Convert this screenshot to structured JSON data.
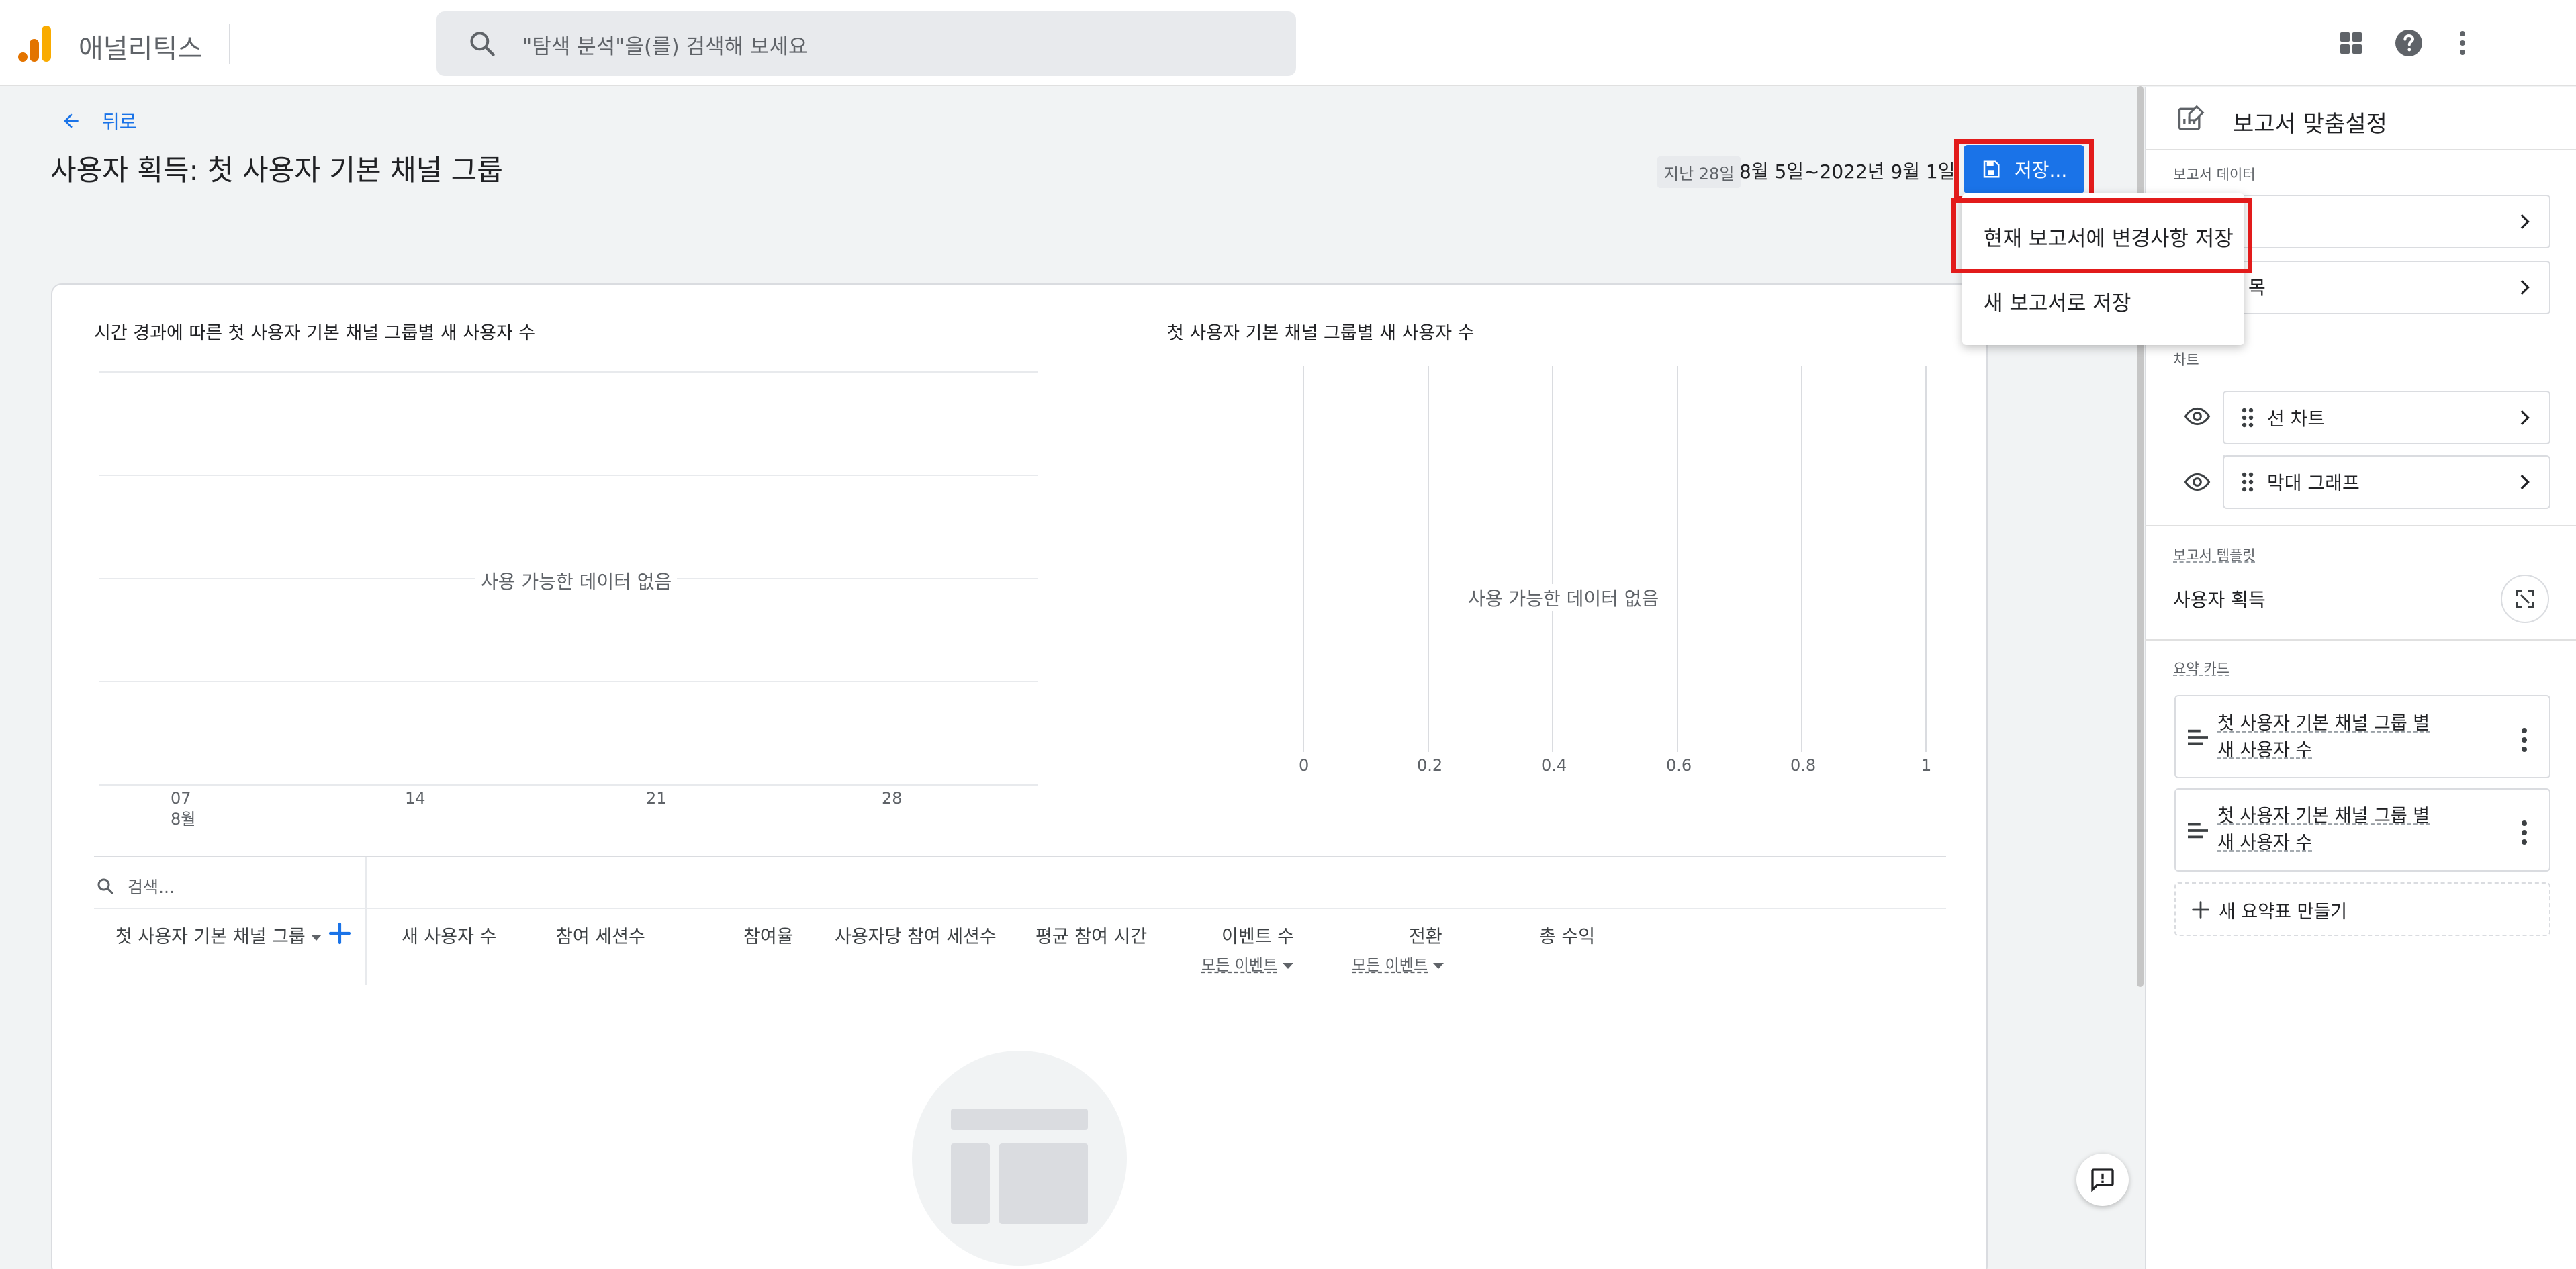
{
  "topbar": {
    "app_title": "애널리틱스",
    "search_placeholder": "\"탐색 분석\"을(를) 검색해 보세요"
  },
  "header": {
    "back_label": "뒤로",
    "page_title": "사용자 획득: 첫 사용자 기본 채널 그룹",
    "date_chip": "지난 28일",
    "date_range": "8월 5일~2022년 9월 1일",
    "save_label": "저장..."
  },
  "save_menu": {
    "items": [
      "현재 보고서에 변경사항 저장",
      "새 보고서로 저장"
    ]
  },
  "line_chart": {
    "title": "시간 경과에 따른 첫 사용자 기본 채널 그룹별 새 사용자 수",
    "no_data": "사용 가능한 데이터 없음",
    "x_ticks": [
      "07",
      "14",
      "21",
      "28"
    ],
    "x_month": "8월"
  },
  "bar_chart": {
    "title": "첫 사용자 기본 채널 그룹별 새 사용자 수",
    "no_data": "사용 가능한 데이터 없음",
    "x_ticks": [
      "0",
      "0.2",
      "0.4",
      "0.6",
      "0.8",
      "1"
    ]
  },
  "table": {
    "search_placeholder": "검색...",
    "dimension_header": "첫 사용자 기본 채널 그룹",
    "columns": [
      "새 사용자 수",
      "참여 세션수",
      "참여율",
      "사용자당 참여 세션수",
      "평균 참여 시간",
      "이벤트 수",
      "전환",
      "총 수익"
    ],
    "event_filter": "모든 이벤트",
    "conversion_filter": "모든 이벤트"
  },
  "panel": {
    "title": "보고서 맞춤설정",
    "report_data_label": "보고서 데이터",
    "row1_text": "",
    "row2_text": "목",
    "chart_label": "차트",
    "charts": [
      "선 차트",
      "막대 그래프"
    ],
    "template_label": "보고서 템플릿",
    "template_name": "사용자 획득",
    "summary_label": "요약 카드",
    "summary_cards": [
      {
        "line1": "첫 사용자 기본 채널 그룹 별",
        "line2": "새 사용자 수"
      },
      {
        "line1": "첫 사용자 기본 채널 그룹 별",
        "line2": "새 사용자 수"
      }
    ],
    "new_summary_label": "새 요약표 만들기"
  },
  "colors": {
    "accent": "#1a73e8",
    "highlight": "#e21b1b",
    "logo_orange": "#f9ab00",
    "logo_dark": "#e37400"
  },
  "chart_data": [
    {
      "type": "line",
      "title": "시간 경과에 따른 첫 사용자 기본 채널 그룹별 새 사용자 수",
      "categories": [
        "07",
        "14",
        "21",
        "28"
      ],
      "series": [],
      "annotation": "사용 가능한 데이터 없음"
    },
    {
      "type": "bar",
      "title": "첫 사용자 기본 채널 그룹별 새 사용자 수",
      "xticks": [
        "0",
        "0.2",
        "0.4",
        "0.6",
        "0.8",
        "1"
      ],
      "xlim": [
        0,
        1
      ],
      "series": [],
      "annotation": "사용 가능한 데이터 없음"
    }
  ]
}
